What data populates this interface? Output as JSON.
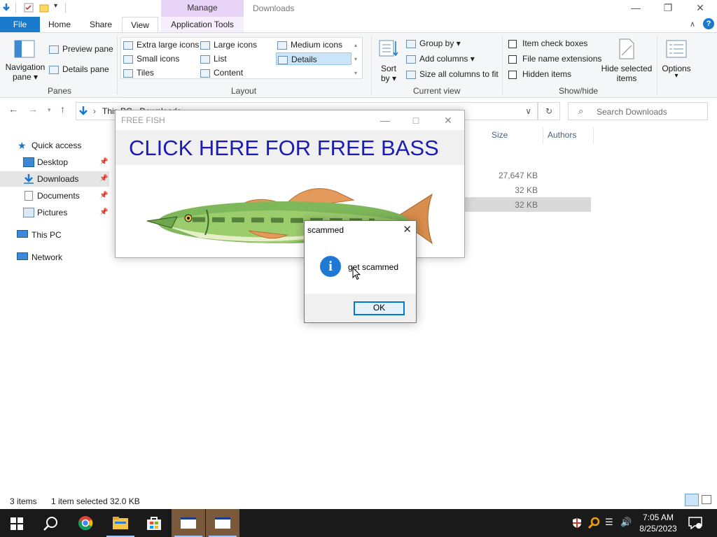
{
  "titlebar": {
    "context_tab": "Manage",
    "window_title": "Downloads",
    "minimize": "—",
    "restore": "❐",
    "close": "✕"
  },
  "ribbon_tabs": {
    "file": "File",
    "home": "Home",
    "share": "Share",
    "view": "View",
    "app_tools": "Application Tools"
  },
  "ribbon": {
    "panes": {
      "label": "Panes",
      "navigation_pane": "Navigation",
      "navigation_pane_2": "pane ▾",
      "preview_pane": "Preview pane",
      "details_pane": "Details pane"
    },
    "layout": {
      "label": "Layout",
      "extra_large": "Extra large icons",
      "large": "Large icons",
      "medium": "Medium icons",
      "small": "Small icons",
      "list": "List",
      "details": "Details",
      "tiles": "Tiles",
      "content": "Content"
    },
    "current_view": {
      "label": "Current view",
      "sort": "Sort",
      "sort_by": "by ▾",
      "group_by": "Group by ▾",
      "add_columns": "Add columns ▾",
      "size_columns": "Size all columns to fit"
    },
    "show_hide": {
      "label": "Show/hide",
      "item_check_boxes": "Item check boxes",
      "file_name_extensions": "File name extensions",
      "hidden_items": "Hidden items",
      "hide_selected": "Hide selected",
      "hide_selected_2": "items"
    },
    "options": "Options",
    "options_arrow": "▾"
  },
  "address": {
    "path": "This PC  ›  Downloads",
    "search_placeholder": "Search Downloads"
  },
  "nav_pane": {
    "quick_access": "Quick access",
    "desktop": "Desktop",
    "downloads": "Downloads",
    "documents": "Documents",
    "pictures": "Pictures",
    "this_pc": "This PC",
    "network": "Network",
    "pin": "📌"
  },
  "file_list": {
    "columns": [
      "Size",
      "Authors"
    ],
    "sizes": [
      "27,647 KB",
      "32 KB",
      "32 KB"
    ]
  },
  "status": {
    "items": "3 items",
    "selected": "1 item selected  32.0 KB"
  },
  "fish_window": {
    "title": "FREE FISH",
    "link_text": "CLICK HERE FOR FREE BASS"
  },
  "dialog": {
    "title": "scammed",
    "message": "get scammed",
    "ok": "OK",
    "close": "✕"
  },
  "taskbar": {
    "time": "7:05 AM",
    "date": "8/25/2023"
  },
  "colors": {
    "accent": "#1979ca",
    "manage_tab": "#e8d4f7",
    "link": "#1b1bb5",
    "info_icon": "#1e79d4"
  }
}
